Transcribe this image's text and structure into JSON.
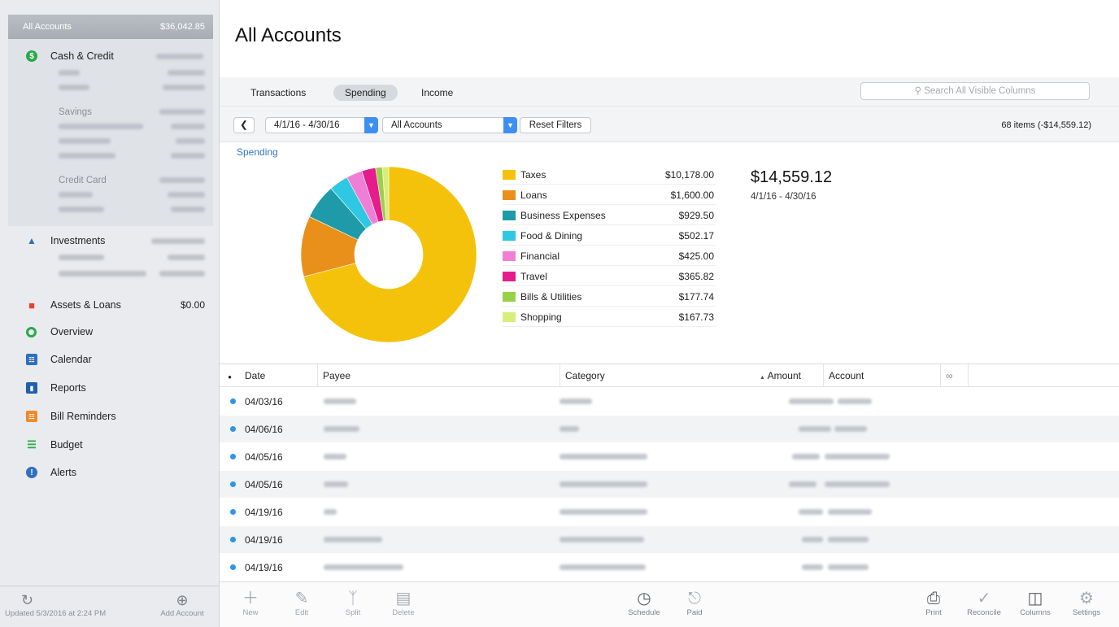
{
  "sidebar": {
    "all_accounts": {
      "label": "All Accounts",
      "amount": "$36,042.85"
    },
    "cash_credit": {
      "label": "Cash & Credit"
    },
    "savings_label": "Savings",
    "credit_card_label": "Credit Card",
    "investments": {
      "label": "Investments"
    },
    "assets_loans": {
      "label": "Assets & Loans",
      "amount": "$0.00"
    },
    "nav": {
      "overview": "Overview",
      "calendar": "Calendar",
      "reports": "Reports",
      "bill_reminders": "Bill Reminders",
      "budget": "Budget",
      "alerts": "Alerts"
    },
    "footer": {
      "updated": "Updated 5/3/2016 at 2:24 PM",
      "add_account": "Add Account"
    }
  },
  "main": {
    "title": "All Accounts",
    "tabs": {
      "transactions": "Transactions",
      "spending": "Spending",
      "income": "Income"
    },
    "search_placeholder": "Search All Visible Columns",
    "filters": {
      "date_range": "4/1/16 - 4/30/16",
      "account": "All Accounts",
      "reset": "Reset Filters",
      "items_count": "68 items (-$14,559.12)"
    },
    "spending_label": "Spending",
    "total": {
      "amount": "$14,559.12",
      "range": "4/1/16 - 4/30/16"
    },
    "table": {
      "headers": {
        "date": "Date",
        "payee": "Payee",
        "category": "Category",
        "amount": "Amount",
        "account": "Account"
      },
      "rows": [
        {
          "date": "04/03/16"
        },
        {
          "date": "04/06/16"
        },
        {
          "date": "04/05/16"
        },
        {
          "date": "04/05/16"
        },
        {
          "date": "04/19/16"
        },
        {
          "date": "04/19/16"
        },
        {
          "date": "04/19/16"
        }
      ]
    },
    "toolbar": {
      "new": "New",
      "edit": "Edit",
      "split": "Split",
      "delete": "Delete",
      "schedule": "Schedule",
      "paid": "Paid",
      "print": "Print",
      "reconcile": "Reconcile",
      "columns": "Columns",
      "settings": "Settings"
    }
  },
  "chart_data": {
    "type": "pie",
    "title": "Spending",
    "donut": true,
    "categories": [
      "Taxes",
      "Loans",
      "Business Expenses",
      "Food & Dining",
      "Financial",
      "Travel",
      "Bills & Utilities",
      "Shopping"
    ],
    "display_values": [
      "$10,178.00",
      "$1,600.00",
      "$929.50",
      "$502.17",
      "$425.00",
      "$365.82",
      "$177.74",
      "$167.73"
    ],
    "values": [
      10178.0,
      1600.0,
      929.5,
      502.17,
      425.0,
      365.82,
      177.74,
      167.73
    ],
    "colors": [
      "#f4c20a",
      "#e8901a",
      "#1e9aa8",
      "#2ec8e2",
      "#ef7fd4",
      "#e61c8c",
      "#9ad14a",
      "#d8ee7a"
    ]
  }
}
